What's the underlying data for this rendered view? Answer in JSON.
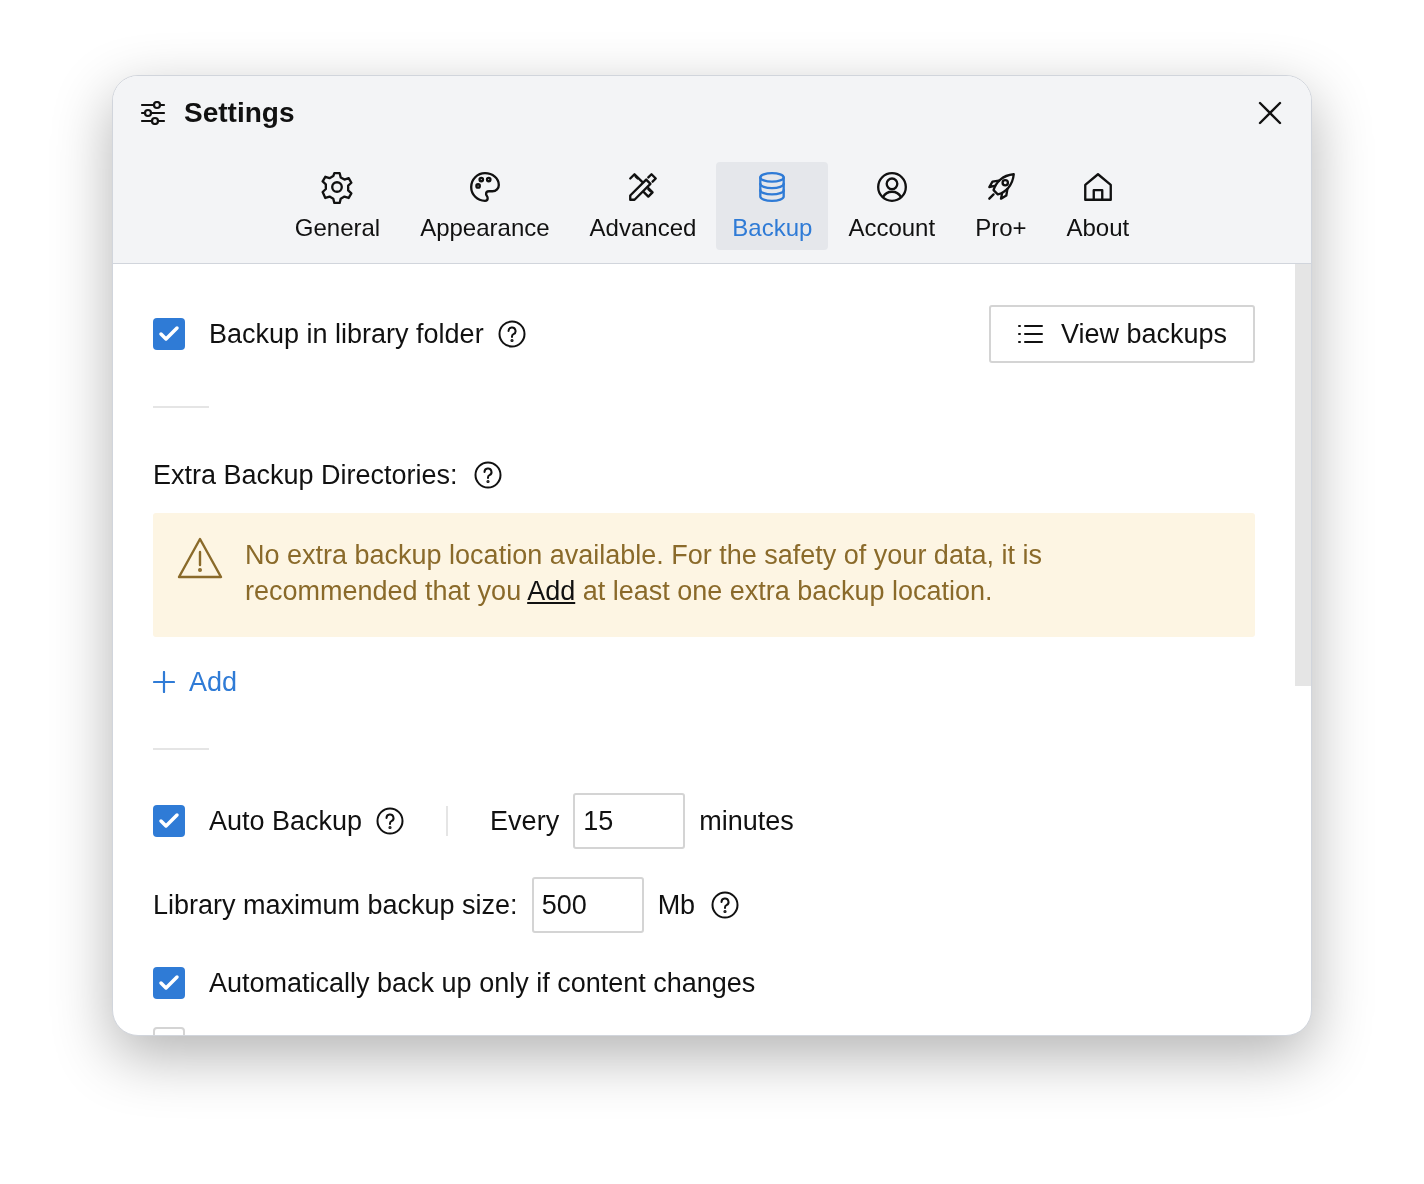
{
  "window": {
    "title": "Settings"
  },
  "tabs": [
    {
      "label": "General",
      "selected": false
    },
    {
      "label": "Appearance",
      "selected": false
    },
    {
      "label": "Advanced",
      "selected": false
    },
    {
      "label": "Backup",
      "selected": true
    },
    {
      "label": "Account",
      "selected": false
    },
    {
      "label": "Pro+",
      "selected": false
    },
    {
      "label": "About",
      "selected": false
    }
  ],
  "library_backup": {
    "label": "Backup in library folder",
    "checked": true
  },
  "view_backups_button": "View backups",
  "extra_directories": {
    "label": "Extra Backup Directories:",
    "warning_before": "No extra backup location available. For the safety of your data, it is recommended that you",
    "warning_link": "Add",
    "warning_after": "at least one extra backup location.",
    "add_button": "Add"
  },
  "auto_backup": {
    "label": "Auto Backup",
    "checked": true,
    "every_label": "Every",
    "interval": "15",
    "unit": "minutes"
  },
  "max_size": {
    "label": "Library maximum backup size:",
    "value": "500",
    "unit": "Mb"
  },
  "options": [
    {
      "label": "Automatically back up only if content changes",
      "checked": true
    },
    {
      "checked": false
    }
  ]
}
